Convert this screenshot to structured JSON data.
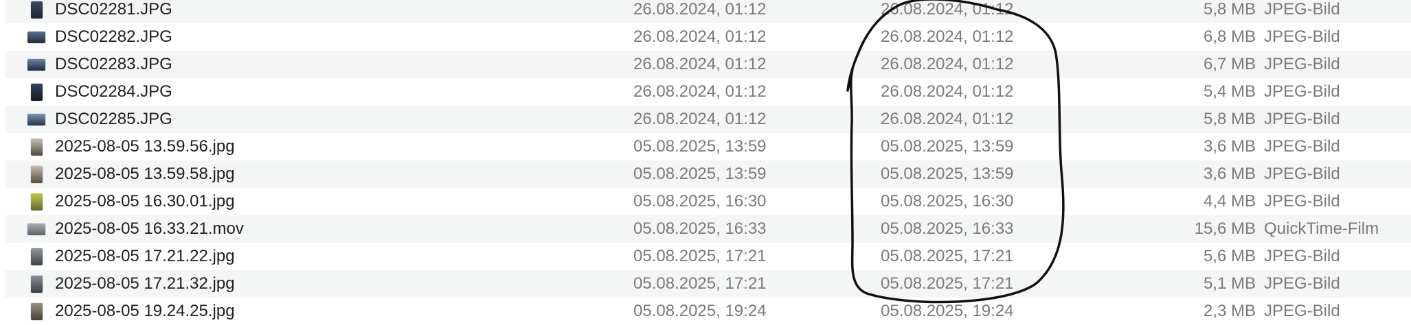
{
  "files": [
    {
      "name": "DSC02281.JPG",
      "created": "26.08.2024, 01:12",
      "modified": "26.08.2024, 01:12",
      "size": "5,8 MB",
      "kind": "JPEG-Bild",
      "thumb": "photo-portrait-icon",
      "thumb_colors": [
        "#3a4a66",
        "#1c2433"
      ]
    },
    {
      "name": "DSC02282.JPG",
      "created": "26.08.2024, 01:12",
      "modified": "26.08.2024, 01:12",
      "size": "6,8 MB",
      "kind": "JPEG-Bild",
      "thumb": "photo-landscape-icon",
      "thumb_colors": [
        "#5a6f8c",
        "#222b3a"
      ]
    },
    {
      "name": "DSC02283.JPG",
      "created": "26.08.2024, 01:12",
      "modified": "26.08.2024, 01:12",
      "size": "6,7 MB",
      "kind": "JPEG-Bild",
      "thumb": "photo-landscape-icon",
      "thumb_colors": [
        "#6e86a6",
        "#1e2a3c"
      ]
    },
    {
      "name": "DSC02284.JPG",
      "created": "26.08.2024, 01:12",
      "modified": "26.08.2024, 01:12",
      "size": "5,4 MB",
      "kind": "JPEG-Bild",
      "thumb": "photo-portrait-icon",
      "thumb_colors": [
        "#33445e",
        "#151b26"
      ]
    },
    {
      "name": "DSC02285.JPG",
      "created": "26.08.2024, 01:12",
      "modified": "26.08.2024, 01:12",
      "size": "5,8 MB",
      "kind": "JPEG-Bild",
      "thumb": "photo-landscape-icon",
      "thumb_colors": [
        "#7c93b0",
        "#2a3546"
      ]
    },
    {
      "name": "2025-08-05 13.59.56.jpg",
      "created": "05.08.2025, 13:59",
      "modified": "05.08.2025, 13:59",
      "size": "3,6 MB",
      "kind": "JPEG-Bild",
      "thumb": "photo-portrait-icon",
      "thumb_colors": [
        "#c9c2b0",
        "#4d4a3f"
      ]
    },
    {
      "name": "2025-08-05 13.59.58.jpg",
      "created": "05.08.2025, 13:59",
      "modified": "05.08.2025, 13:59",
      "size": "3,6 MB",
      "kind": "JPEG-Bild",
      "thumb": "photo-portrait-icon",
      "thumb_colors": [
        "#c4bca8",
        "#57503f"
      ]
    },
    {
      "name": "2025-08-05 16.30.01.jpg",
      "created": "05.08.2025, 16:30",
      "modified": "05.08.2025, 16:30",
      "size": "4,4 MB",
      "kind": "JPEG-Bild",
      "thumb": "photo-portrait-icon",
      "thumb_colors": [
        "#c2c94a",
        "#5d6a2c"
      ]
    },
    {
      "name": "2025-08-05 16.33.21.mov",
      "created": "05.08.2025, 16:33",
      "modified": "05.08.2025, 16:33",
      "size": "15,6 MB",
      "kind": "QuickTime-Film",
      "thumb": "video-thumbnail-icon",
      "thumb_colors": [
        "#a9aeb4",
        "#5b636b"
      ]
    },
    {
      "name": "2025-08-05 17.21.22.jpg",
      "created": "05.08.2025, 17:21",
      "modified": "05.08.2025, 17:21",
      "size": "5,6 MB",
      "kind": "JPEG-Bild",
      "thumb": "photo-portrait-icon",
      "thumb_colors": [
        "#8f969c",
        "#3d4247"
      ]
    },
    {
      "name": "2025-08-05 17.21.32.jpg",
      "created": "05.08.2025, 17:21",
      "modified": "05.08.2025, 17:21",
      "size": "5,1 MB",
      "kind": "JPEG-Bild",
      "thumb": "photo-portrait-icon",
      "thumb_colors": [
        "#8a9196",
        "#3a3f44"
      ]
    },
    {
      "name": "2025-08-05 19.24.25.jpg",
      "created": "05.08.2025, 19:24",
      "modified": "05.08.2025, 19:24",
      "size": "2,3 MB",
      "kind": "JPEG-Bild",
      "thumb": "photo-portrait-icon",
      "thumb_colors": [
        "#9a8f7c",
        "#4a4236"
      ]
    }
  ],
  "colors": {
    "name_text": "#1e1e1e",
    "secondary_text": "#7a7a7a",
    "row_stripe": "#f4f5f5",
    "annotation_ink": "#111111"
  }
}
